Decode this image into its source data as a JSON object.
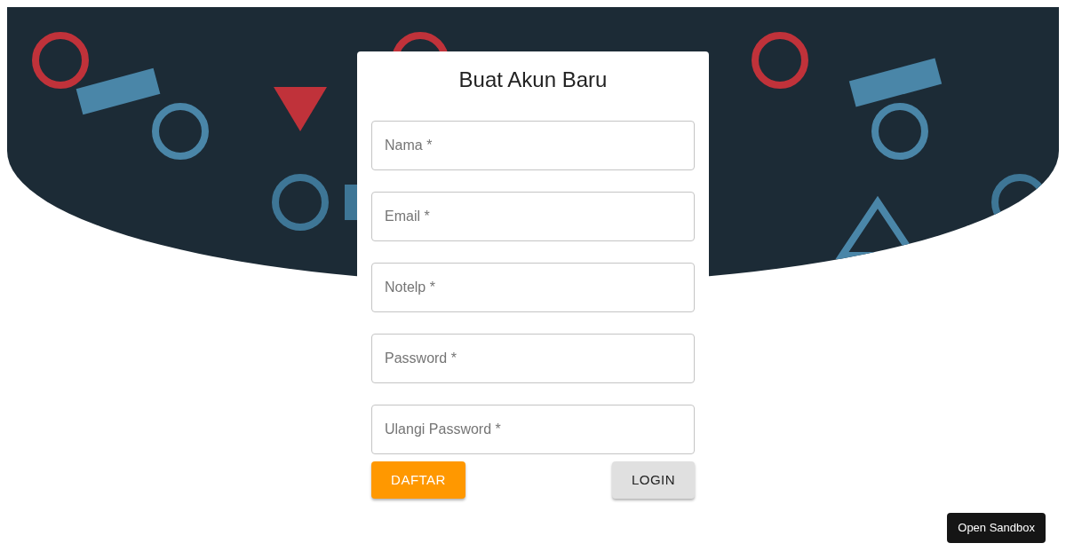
{
  "form": {
    "title": "Buat Akun Baru",
    "fields": [
      {
        "placeholder": "Nama *"
      },
      {
        "placeholder": "Email *"
      },
      {
        "placeholder": "Notelp *"
      },
      {
        "placeholder": "Password *"
      },
      {
        "placeholder": "Ulangi Password *"
      }
    ],
    "buttons": [
      {
        "label": "DAFTAR",
        "kind": "primary"
      },
      {
        "label": "LOGIN",
        "kind": "secondary"
      }
    ]
  },
  "sandbox_button": "Open Sandbox"
}
